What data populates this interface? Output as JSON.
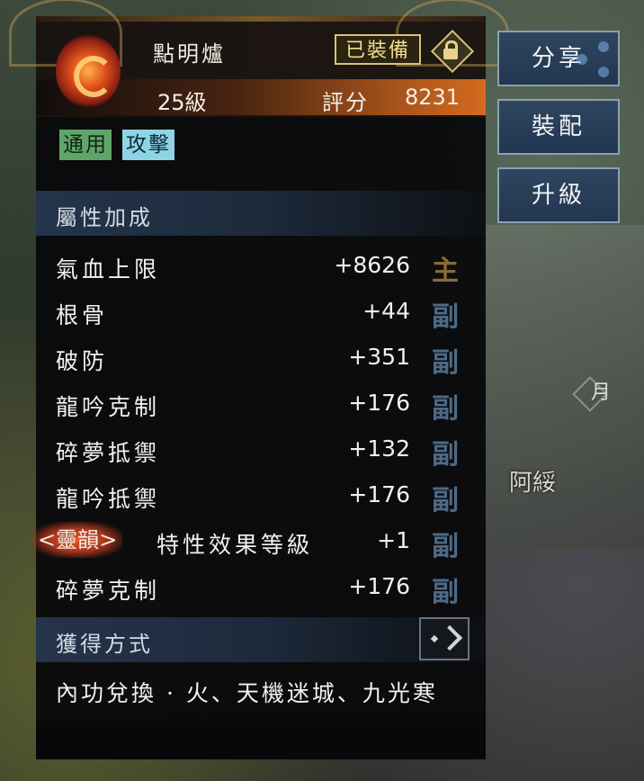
{
  "item": {
    "name": "點明爐",
    "level": "25級",
    "score_label": "評分",
    "score_value": "8231",
    "equipped_label": "已裝備",
    "lock_icon": "lock-icon"
  },
  "tags": {
    "general": "通用",
    "attack": "攻擊"
  },
  "attributes": {
    "title": "屬性加成",
    "rows": [
      {
        "name": "氣血上限",
        "value": "+8626",
        "type": "主"
      },
      {
        "name": "根骨",
        "value": "+44",
        "type": "副"
      },
      {
        "name": "破防",
        "value": "+351",
        "type": "副"
      },
      {
        "name": "龍吟克制",
        "value": "+176",
        "type": "副"
      },
      {
        "name": "碎夢抵禦",
        "value": "+132",
        "type": "副"
      },
      {
        "name": "龍吟抵禦",
        "value": "+176",
        "type": "副"
      }
    ],
    "special": {
      "prefix": "<靈韻>",
      "name": "特性效果等級",
      "value": "+1",
      "type": "副"
    },
    "last_row": {
      "name": "碎夢克制",
      "value": "+176",
      "type": "副"
    }
  },
  "obtain": {
    "title": "獲得方式",
    "description": "內功兌換 · 火、天機迷城、九光寒"
  },
  "side_buttons": {
    "share": "分享",
    "equip": "裝配",
    "upgrade": "升級"
  },
  "background": {
    "npc_name": "阿綏",
    "moon_marker": "月"
  },
  "colors": {
    "header_stripe": "#d46a1e",
    "tag_general_bg": "#5fa56a",
    "tag_attack_bg": "#8fd3e6",
    "main_marker": "#8a6a34",
    "sub_marker": "#4d6a86",
    "button_bg": "#2f4660"
  }
}
